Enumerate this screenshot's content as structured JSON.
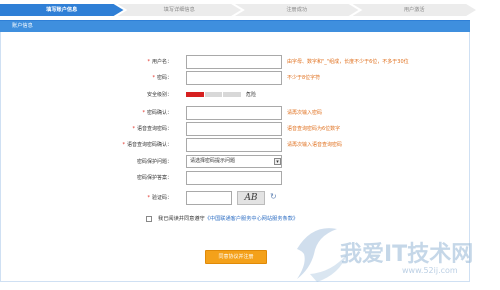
{
  "steps": [
    {
      "label": "填写账户信息",
      "active": true
    },
    {
      "label": "填写详细信息",
      "active": false
    },
    {
      "label": "注册成功",
      "active": false
    },
    {
      "label": "用户激活",
      "active": false
    }
  ],
  "section_title": "账户信息",
  "form": {
    "username": {
      "label": "用户名：",
      "value": "",
      "hint": "由字母、数字和\"_\"组成，长度不少于6位，不多于30位"
    },
    "password": {
      "label": "密码：",
      "value": "",
      "hint": "不少于8位字符"
    },
    "strength": {
      "label": "安全级别：",
      "text": "危险",
      "level": 0.33
    },
    "password_confirm": {
      "label": "密码确认：",
      "value": "",
      "hint": "请再次输入密码"
    },
    "voice_password": {
      "label": "语音查询密码：",
      "value": "",
      "hint": "语音查询密码为6位数字"
    },
    "voice_password_confirm": {
      "label": "语音查询密码确认：",
      "value": "",
      "hint": "请再次输入语音查询密码"
    },
    "security_question": {
      "label": "密码保护问题：",
      "selected": "请选择密码提示问题"
    },
    "security_answer": {
      "label": "密码保护答案：",
      "value": ""
    },
    "captcha": {
      "label": "验证码：",
      "value": "",
      "image_text": "AB"
    },
    "agree": {
      "text": "我已阅读并同意遵守",
      "link": "《中国联通客户服务中心网站服务条款》"
    },
    "submit_label": "同意协议并注册"
  },
  "watermark": {
    "text": "我爱IT技术网",
    "url": "www.52ij.com"
  },
  "colors": {
    "accent": "#2f7fd6",
    "hint": "#e0701e",
    "required": "#e0281e",
    "button": "#f4a11a",
    "danger": "#d62020"
  }
}
